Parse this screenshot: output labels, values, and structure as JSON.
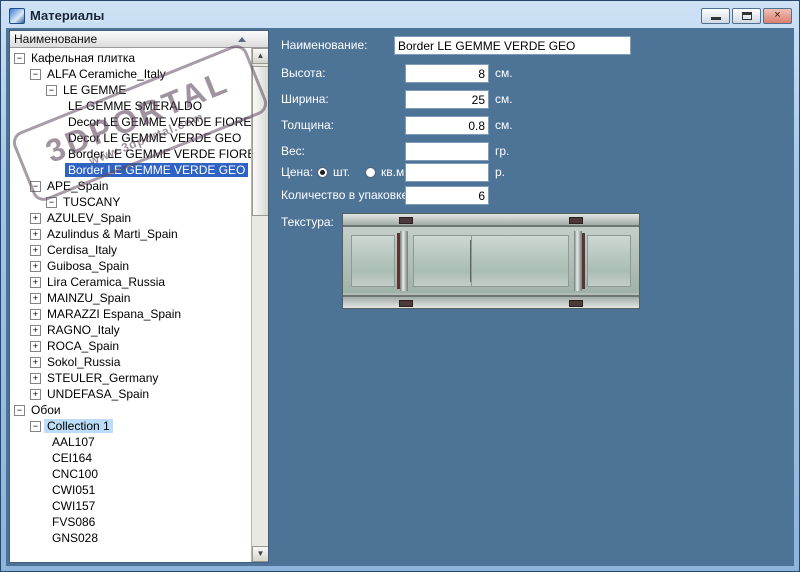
{
  "window": {
    "title": "Материалы",
    "close_glyph": "×"
  },
  "colors": {
    "panel_bg": "#4d7397",
    "selection": "#2e63c4",
    "soft_selection": "#bcdcf8"
  },
  "tree": {
    "header": "Наименование",
    "items": [
      {
        "label": "Кафельная плитка",
        "depth": 0,
        "glyph": "minus"
      },
      {
        "label": "ALFA Ceramiche_Italy",
        "depth": 1,
        "glyph": "minus"
      },
      {
        "label": "LE GEMME",
        "depth": 2,
        "glyph": "minus"
      },
      {
        "label": "LE GEMME SMERALDO",
        "depth": 3,
        "glyph": "none"
      },
      {
        "label": "Decor LE GEMME VERDE FIORE",
        "depth": 3,
        "glyph": "none"
      },
      {
        "label": "Decor LE GEMME VERDE GEO",
        "depth": 3,
        "glyph": "none"
      },
      {
        "label": "Border LE GEMME VERDE FIORE",
        "depth": 3,
        "glyph": "none"
      },
      {
        "label": "Border LE GEMME VERDE GEO",
        "depth": 3,
        "glyph": "none",
        "selected": true
      },
      {
        "label": "APE_Spain",
        "depth": 1,
        "glyph": "minus"
      },
      {
        "label": "TUSCANY",
        "depth": 2,
        "glyph": "minus"
      },
      {
        "label": "AZULEV_Spain",
        "depth": 1,
        "glyph": "plus"
      },
      {
        "label": "Azulindus & Marti_Spain",
        "depth": 1,
        "glyph": "plus"
      },
      {
        "label": "Cerdisa_Italy",
        "depth": 1,
        "glyph": "plus"
      },
      {
        "label": "Guibosa_Spain",
        "depth": 1,
        "glyph": "plus"
      },
      {
        "label": "Lira Ceramica_Russia",
        "depth": 1,
        "glyph": "plus"
      },
      {
        "label": "MAINZU_Spain",
        "depth": 1,
        "glyph": "plus"
      },
      {
        "label": "MARAZZI Espana_Spain",
        "depth": 1,
        "glyph": "plus"
      },
      {
        "label": "RAGNO_Italy",
        "depth": 1,
        "glyph": "plus"
      },
      {
        "label": "ROCA_Spain",
        "depth": 1,
        "glyph": "plus"
      },
      {
        "label": "Sokol_Russia",
        "depth": 1,
        "glyph": "plus"
      },
      {
        "label": "STEULER_Germany",
        "depth": 1,
        "glyph": "plus"
      },
      {
        "label": "UNDEFASA_Spain",
        "depth": 1,
        "glyph": "plus"
      },
      {
        "label": "Обои",
        "depth": 0,
        "glyph": "minus"
      },
      {
        "label": "Collection 1",
        "depth": 1,
        "glyph": "minus",
        "soft": true
      },
      {
        "label": "AAL107",
        "depth": 2,
        "glyph": "none"
      },
      {
        "label": "CEI164",
        "depth": 2,
        "glyph": "none"
      },
      {
        "label": "CNC100",
        "depth": 2,
        "glyph": "none"
      },
      {
        "label": "CWI051",
        "depth": 2,
        "glyph": "none"
      },
      {
        "label": "CWI157",
        "depth": 2,
        "glyph": "none"
      },
      {
        "label": "FVS086",
        "depth": 2,
        "glyph": "none"
      },
      {
        "label": "GNS028",
        "depth": 2,
        "glyph": "none"
      }
    ]
  },
  "form": {
    "name": {
      "label": "Наименование:",
      "value": "Border LE GEMME VERDE GEO"
    },
    "rows": [
      {
        "label": "Высота:",
        "value": "8",
        "unit": "см."
      },
      {
        "label": "Ширина:",
        "value": "25",
        "unit": "см."
      },
      {
        "label": "Толщина:",
        "value": "0.8",
        "unit": "см."
      },
      {
        "label": "Вес:",
        "value": "",
        "unit": "гр."
      }
    ],
    "price": {
      "label": "Цена:",
      "options": [
        {
          "label": "шт.",
          "checked": true
        },
        {
          "label": "кв.м.",
          "checked": false
        }
      ],
      "value": "",
      "unit": "р."
    },
    "pack": {
      "label": "Количество в упаковке:",
      "value": "6"
    },
    "texture_label": "Текстура:"
  },
  "stamp": {
    "line1": "3DPORTAL",
    "line2": "www.3dportal.com"
  }
}
